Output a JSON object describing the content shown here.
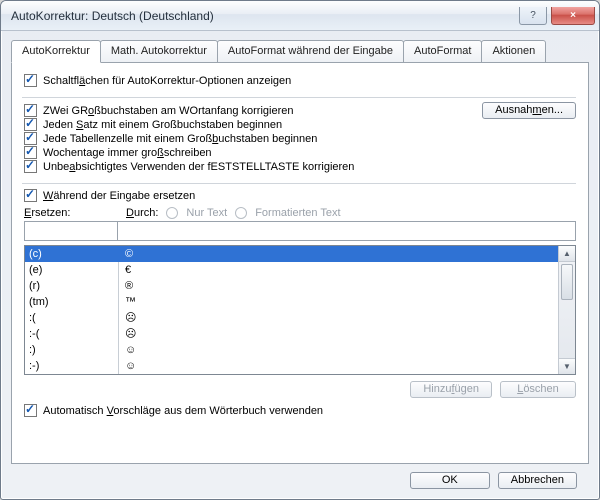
{
  "window": {
    "title": "AutoKorrektur: Deutsch (Deutschland)"
  },
  "winbuttons": {
    "help": "?",
    "close": "×"
  },
  "tabs": [
    {
      "label": "AutoKorrektur",
      "active": true
    },
    {
      "label": "Math. Autokorrektur"
    },
    {
      "label": "AutoFormat während der Eingabe"
    },
    {
      "label": "AutoFormat"
    },
    {
      "label": "Aktionen"
    }
  ],
  "show_buttons": {
    "pre": "Schaltfl",
    "u": "ä",
    "post": "chen für AutoKorrektur-Optionen anzeigen"
  },
  "options": [
    {
      "pre": "ZWei GR",
      "u": "o",
      "post": "ßbuchstaben am WOrtanfang korrigieren"
    },
    {
      "pre": "Jeden ",
      "u": "S",
      "post": "atz mit einem Großbuchstaben beginnen"
    },
    {
      "pre": "Jede Tabellenzelle mit einem Groß",
      "u": "b",
      "post": "uchstaben beginnen"
    },
    {
      "pre": "Wochentage immer gro",
      "u": "ß",
      "post": "schreiben"
    },
    {
      "pre": "Unbe",
      "u": "a",
      "post": "bsichtigtes Verwenden der fESTSTELLTASTE korrigieren"
    }
  ],
  "exceptions": {
    "pre": "Ausnah",
    "u": "m",
    "post": "en..."
  },
  "replace_during": {
    "pre": "",
    "u": "W",
    "post": "ährend der Eingabe ersetzen"
  },
  "replace_label": {
    "pre": "",
    "u": "E",
    "post": "rsetzen:"
  },
  "with_label": {
    "pre": "",
    "u": "D",
    "post": "urch:"
  },
  "radios": {
    "plain": "Nur Text",
    "formatted": "Formatierten Text"
  },
  "list": [
    {
      "a": "(c)",
      "b": "©",
      "selected": true
    },
    {
      "a": "(e)",
      "b": "€"
    },
    {
      "a": "(r)",
      "b": "®"
    },
    {
      "a": "(tm)",
      "b": "™"
    },
    {
      "a": ":(",
      "b": "☹"
    },
    {
      "a": ":-(",
      "b": "☹"
    },
    {
      "a": ":)",
      "b": "☺"
    },
    {
      "a": ":-)",
      "b": "☺"
    }
  ],
  "buttons": {
    "add": {
      "pre": "Hinzu",
      "u": "f",
      "post": "ügen"
    },
    "delete": {
      "pre": "",
      "u": "L",
      "post": "öschen"
    }
  },
  "auto_dict": {
    "pre": "Automatisch ",
    "u": "V",
    "post": "orschläge aus dem Wörterbuch verwenden"
  },
  "footer": {
    "ok": "OK",
    "cancel": "Abbrechen"
  }
}
